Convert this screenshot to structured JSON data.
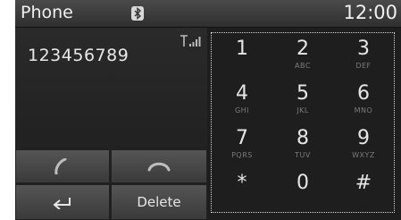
{
  "header": {
    "title": "Phone",
    "bluetooth_icon": "bluetooth-icon",
    "time": "12:00"
  },
  "status": {
    "signal_icon": "signal-strength-icon"
  },
  "dial": {
    "number": "123456789"
  },
  "controls": {
    "call_icon": "handset-call-icon",
    "end_icon": "handset-end-icon",
    "back_icon": "back-arrow-icon",
    "delete_label": "Delete"
  },
  "keypad": {
    "keys": [
      {
        "digit": "1",
        "letters": ""
      },
      {
        "digit": "2",
        "letters": "ABC"
      },
      {
        "digit": "3",
        "letters": "DEF"
      },
      {
        "digit": "4",
        "letters": "GHI"
      },
      {
        "digit": "5",
        "letters": "JKL"
      },
      {
        "digit": "6",
        "letters": "MNO"
      },
      {
        "digit": "7",
        "letters": "PQRS"
      },
      {
        "digit": "8",
        "letters": "TUV"
      },
      {
        "digit": "9",
        "letters": "WXYZ"
      },
      {
        "digit": "*",
        "letters": ""
      },
      {
        "digit": "0",
        "letters": ""
      },
      {
        "digit": "#",
        "letters": ""
      }
    ]
  }
}
